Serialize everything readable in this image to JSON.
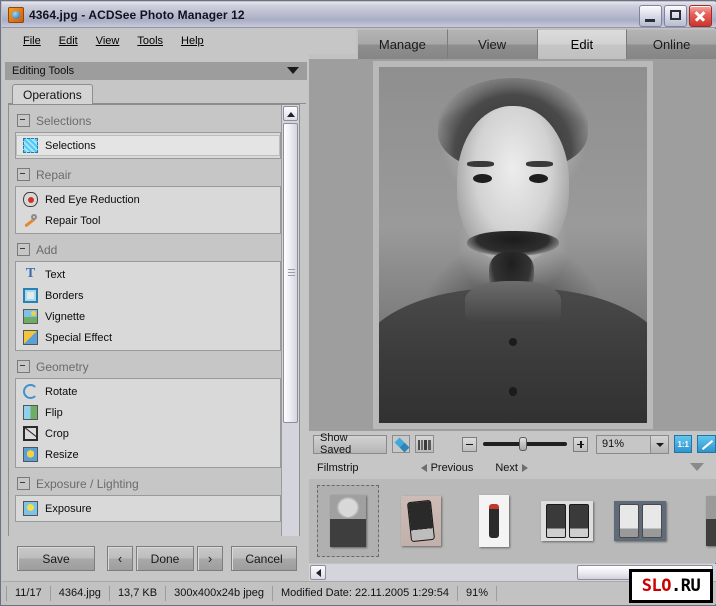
{
  "window": {
    "title": "4364.jpg - ACDSee Photo Manager 12",
    "icon": "acdsee-app-icon",
    "minimize": "–",
    "maximize": "□",
    "close": "✕"
  },
  "menubar": {
    "items": [
      {
        "label": "File"
      },
      {
        "label": "Edit"
      },
      {
        "label": "View"
      },
      {
        "label": "Tools"
      },
      {
        "label": "Help"
      }
    ]
  },
  "mode_tabs": {
    "items": [
      {
        "label": "Manage",
        "active": false
      },
      {
        "label": "View",
        "active": false
      },
      {
        "label": "Edit",
        "active": true
      },
      {
        "label": "Online",
        "active": false
      }
    ]
  },
  "editing_tools": {
    "header": "Editing Tools",
    "tab": "Operations",
    "groups": [
      {
        "name": "Selections",
        "items": [
          {
            "label": "Selections",
            "icon": "selection-icon",
            "selected": true
          }
        ]
      },
      {
        "name": "Repair",
        "items": [
          {
            "label": "Red Eye Reduction",
            "icon": "red-eye-icon",
            "selected": false
          },
          {
            "label": "Repair Tool",
            "icon": "wrench-icon",
            "selected": false
          }
        ]
      },
      {
        "name": "Add",
        "items": [
          {
            "label": "Text",
            "icon": "text-icon",
            "selected": false
          },
          {
            "label": "Borders",
            "icon": "borders-icon",
            "selected": false
          },
          {
            "label": "Vignette",
            "icon": "vignette-icon",
            "selected": false
          },
          {
            "label": "Special Effect",
            "icon": "special-effect-icon",
            "selected": false
          }
        ]
      },
      {
        "name": "Geometry",
        "items": [
          {
            "label": "Rotate",
            "icon": "rotate-icon",
            "selected": false
          },
          {
            "label": "Flip",
            "icon": "flip-icon",
            "selected": false
          },
          {
            "label": "Crop",
            "icon": "crop-icon",
            "selected": false
          },
          {
            "label": "Resize",
            "icon": "resize-icon",
            "selected": false
          }
        ]
      },
      {
        "name": "Exposure / Lighting",
        "items": [
          {
            "label": "Exposure",
            "icon": "exposure-icon",
            "selected": false
          }
        ]
      }
    ]
  },
  "actions": {
    "save": "Save",
    "previous": "‹",
    "done": "Done",
    "next": "›",
    "cancel": "Cancel"
  },
  "image_toolbar": {
    "show_saved": "Show Saved",
    "compare_icon": "compare-arrows-icon",
    "histogram_icon": "histogram-icon",
    "zoom_out": "zoom-out-icon",
    "zoom_in": "zoom-in-icon",
    "zoom_value": "91%",
    "actual_size": "1:1",
    "fit_image": "fit-image-icon"
  },
  "filmstrip": {
    "title": "Filmstrip",
    "previous": "Previous",
    "next": "Next",
    "collapse_icon": "collapse-caret-icon",
    "thumbnails": [
      {
        "name": "thumb-portrait",
        "selected": true
      },
      {
        "name": "thumb-pda-single",
        "selected": false
      },
      {
        "name": "thumb-figure",
        "selected": false
      },
      {
        "name": "thumb-pda-pair-light",
        "selected": false
      },
      {
        "name": "thumb-pda-pair-blue",
        "selected": false
      },
      {
        "name": "thumb-partial",
        "selected": false
      }
    ]
  },
  "statusbar": {
    "position": "11/17",
    "filename": "4364.jpg",
    "filesize": "13,7 KB",
    "dimensions": "300x400x24b jpeg",
    "modified": "Modified Date: 22.11.2005 1:29:54",
    "zoom": "91%"
  },
  "watermark": {
    "red_part": "SLO",
    "black_part": ".RU"
  },
  "colors": {
    "window_bg": "#c6c6c6",
    "titlebar": "#b9bccf",
    "panel_header": "#9d9d9d",
    "image_bg": "#9e9e9e",
    "accent_blue": "#2f94cd",
    "watermark_red": "#cc0000"
  }
}
